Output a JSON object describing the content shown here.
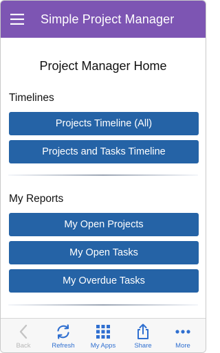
{
  "app_bar": {
    "title": "Simple Project Manager",
    "menu_icon": "hamburger-menu-icon",
    "color": "#7d55b3"
  },
  "main": {
    "page_title": "Project Manager Home",
    "sections": [
      {
        "heading": "Timelines",
        "buttons": [
          "Projects Timeline (All)",
          "Projects and Tasks Timeline"
        ]
      },
      {
        "heading": "My Reports",
        "buttons": [
          "My Open Projects",
          "My Open Tasks",
          "My Overdue Tasks"
        ]
      }
    ],
    "button_color": "#2563a6"
  },
  "tab_bar": {
    "items": [
      {
        "label": "Back",
        "icon": "chevron-left-icon",
        "enabled": false
      },
      {
        "label": "Refresh",
        "icon": "refresh-icon",
        "enabled": true
      },
      {
        "label": "My Apps",
        "icon": "grid-icon",
        "enabled": true
      },
      {
        "label": "Share",
        "icon": "share-icon",
        "enabled": true
      },
      {
        "label": "More",
        "icon": "more-dots-icon",
        "enabled": true
      }
    ],
    "accent": "#2f6fd0"
  }
}
